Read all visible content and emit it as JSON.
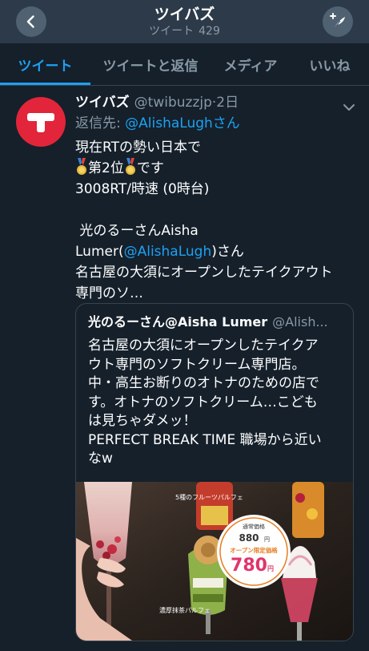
{
  "header": {
    "title": "ツイバズ",
    "subtitle_label": "ツイート",
    "subtitle_count": "429"
  },
  "tabs": [
    {
      "label": "ツイート",
      "active": true
    },
    {
      "label": "ツイートと返信",
      "active": false
    },
    {
      "label": "メディア",
      "active": false
    },
    {
      "label": "いいね",
      "active": false
    }
  ],
  "tweet": {
    "name": "ツイバズ",
    "handle": "@twibuzzjp",
    "separator": "·",
    "time": "2日",
    "reply_prefix": "返信先: ",
    "reply_mention": "@AlishaLughさん",
    "lines": {
      "l1": "現在RTの勢い日本で",
      "l2_mid": "第2位",
      "l2_end": "です",
      "l3": "3008RT/時速 (0時台)",
      "l5": " 光のるーさんAisha",
      "l6_pre": "Lumer(",
      "l6_mention": "@AlishaLugh",
      "l6_post": ")さん",
      "l7": "名古屋の大須にオープンしたテイクアウト",
      "l8": "専門のソ…"
    }
  },
  "quote": {
    "name": "光のるーさん@Aisha Lumer",
    "handle": "@Alish...",
    "lines": [
      "名古屋の大須にオープンしたテイクア",
      "ウト専門のソフトクリーム専門店。",
      "中・高生お断りのオトナのための店で",
      "す。オトナのソフトクリーム…こども",
      "は見ちゃダメッ！",
      "PERFECT BREAK TIME 職場から近い",
      "なw"
    ],
    "image": {
      "label_top": "5種のフルーツパルフェ",
      "label_bottom": "濃厚抹茶パルフェ",
      "price_regular_label": "通常価格",
      "price_regular": "880",
      "price_regular_unit": "円",
      "price_sale_label": "オープン限定価格",
      "price_sale": "780",
      "price_sale_unit": "円"
    }
  },
  "colors": {
    "background": "#15202b",
    "header": "#2c3a4a",
    "accent": "#1da1f2",
    "muted": "#8899a6",
    "avatar": "#e2253a"
  },
  "icons": [
    "back-arrow-icon",
    "compose-tweet-icon",
    "chevron-down-icon",
    "medal-icon"
  ]
}
